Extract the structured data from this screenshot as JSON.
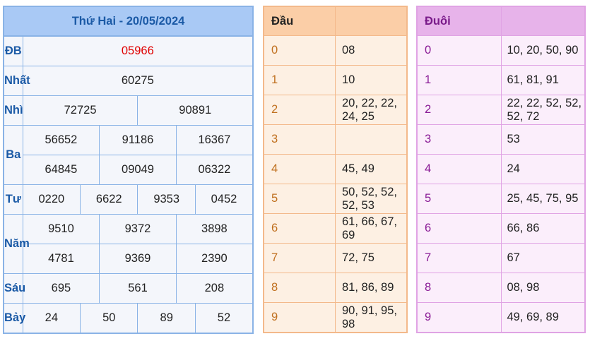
{
  "results": {
    "title": "Thứ Hai - 20/05/2024",
    "prizes": [
      {
        "label": "ĐB",
        "rows": [
          [
            "05966"
          ]
        ],
        "special": true
      },
      {
        "label": "Nhất",
        "rows": [
          [
            "60275"
          ]
        ]
      },
      {
        "label": "Nhì",
        "rows": [
          [
            "72725",
            "90891"
          ]
        ]
      },
      {
        "label": "Ba",
        "rows": [
          [
            "56652",
            "91186",
            "16367"
          ],
          [
            "64845",
            "09049",
            "06322"
          ]
        ]
      },
      {
        "label": "Tư",
        "rows": [
          [
            "0220",
            "6622",
            "9353",
            "0452"
          ]
        ]
      },
      {
        "label": "Năm",
        "rows": [
          [
            "9510",
            "9372",
            "3898"
          ],
          [
            "4781",
            "9369",
            "2390"
          ]
        ]
      },
      {
        "label": "Sáu",
        "rows": [
          [
            "695",
            "561",
            "208"
          ]
        ]
      },
      {
        "label": "Bảy",
        "rows": [
          [
            "24",
            "50",
            "89",
            "52"
          ]
        ]
      }
    ]
  },
  "dau": {
    "header": "Đầu",
    "rows": [
      {
        "k": "0",
        "v": "08"
      },
      {
        "k": "1",
        "v": "10"
      },
      {
        "k": "2",
        "v": "20, 22, 22, 24, 25"
      },
      {
        "k": "3",
        "v": ""
      },
      {
        "k": "4",
        "v": "45, 49"
      },
      {
        "k": "5",
        "v": "50, 52, 52, 52, 53"
      },
      {
        "k": "6",
        "v": "61, 66, 67, 69"
      },
      {
        "k": "7",
        "v": "72, 75"
      },
      {
        "k": "8",
        "v": "81, 86, 89"
      },
      {
        "k": "9",
        "v": "90, 91, 95, 98"
      }
    ]
  },
  "duoi": {
    "header": "Đuôi",
    "rows": [
      {
        "k": "0",
        "v": "10, 20, 50, 90"
      },
      {
        "k": "1",
        "v": "61, 81, 91"
      },
      {
        "k": "2",
        "v": "22, 22, 52, 52, 52, 72"
      },
      {
        "k": "3",
        "v": "53"
      },
      {
        "k": "4",
        "v": "24"
      },
      {
        "k": "5",
        "v": "25, 45, 75, 95"
      },
      {
        "k": "6",
        "v": "66, 86"
      },
      {
        "k": "7",
        "v": "67"
      },
      {
        "k": "8",
        "v": "08, 98"
      },
      {
        "k": "9",
        "v": "49, 69, 89"
      }
    ]
  }
}
